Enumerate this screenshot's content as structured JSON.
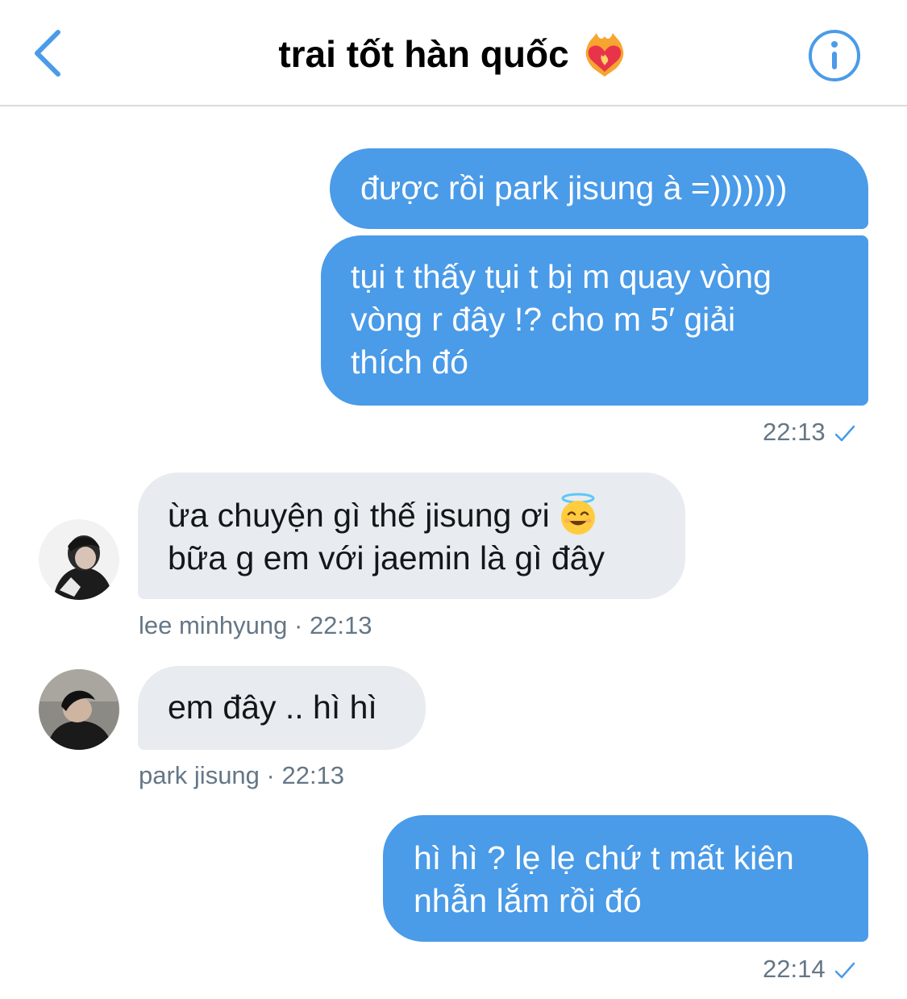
{
  "header": {
    "title": "trai tốt hàn quốc",
    "title_emoji": "heart-on-fire-icon",
    "back_icon": "chevron-left-icon",
    "info_icon": "info-icon"
  },
  "colors": {
    "accent": "#4a9be8",
    "incoming_bubble": "#e8ebef",
    "meta_text": "#657786"
  },
  "messages": [
    {
      "direction": "outgoing",
      "text": "được rồi park jisung à =)))))))"
    },
    {
      "direction": "outgoing",
      "lines": [
        "tụi t thấy tụi t bị m quay vòng",
        "vòng r đây !? cho m 5′ giải",
        "thích đó"
      ],
      "time": "22:13",
      "status_icon": "checkmark-icon"
    },
    {
      "direction": "incoming",
      "sender": "lee minhyung",
      "lines": [
        "ừa chuyện gì thế jisung ơi",
        "bữa g em với jaemin là gì đây"
      ],
      "emoji": "smiling-face-with-halo-icon",
      "time": "22:13",
      "meta": "lee minhyung · 22:13"
    },
    {
      "direction": "incoming",
      "sender": "park jisung",
      "text": "em đây .. hì hì",
      "time": "22:13",
      "meta": "park jisung · 22:13"
    },
    {
      "direction": "outgoing",
      "lines": [
        "hì hì ? lẹ lẹ chứ t mất kiên",
        "nhẫn lắm rồi đó"
      ],
      "time": "22:14",
      "status_icon": "checkmark-icon"
    }
  ]
}
